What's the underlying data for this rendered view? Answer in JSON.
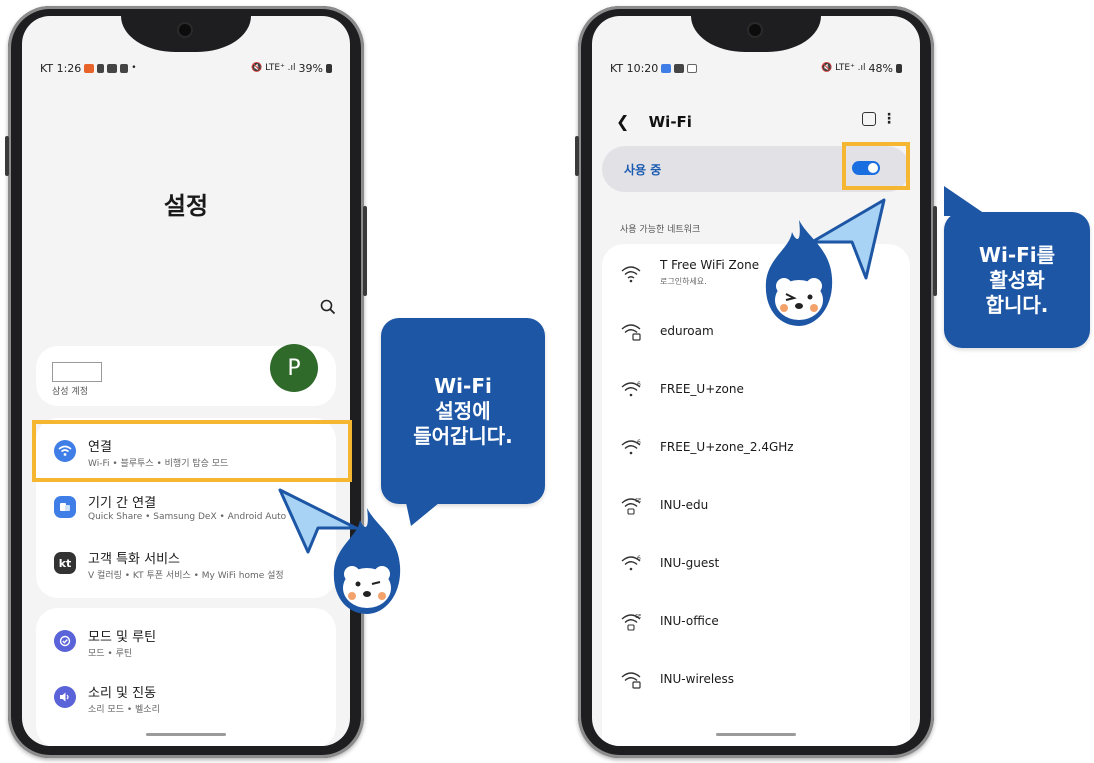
{
  "left_phone": {
    "status": {
      "time": "KT 1:26",
      "battery": "39%"
    },
    "title": "설정",
    "account": {
      "label": "삼성 계정",
      "avatar_letter": "P"
    },
    "menu": [
      {
        "title": "연결",
        "subtitle": "Wi-Fi • 블루투스 • 비행기 탑승 모드",
        "icon": "wifi-icon",
        "color": "#3f7ee6"
      },
      {
        "title": "기기 간 연결",
        "subtitle": "Quick Share • Samsung DeX • Android Auto",
        "icon": "devices-icon",
        "color": "#3f7ee6"
      },
      {
        "title": "고객 특화 서비스",
        "subtitle": "V 컬러링 • KT 투폰 서비스 • My WiFi home 설정",
        "icon": "kt-icon",
        "color": "#333333"
      },
      {
        "title": "모드 및 루틴",
        "subtitle": "모드 • 루틴",
        "icon": "routine-icon",
        "color": "#5a63d8"
      },
      {
        "title": "소리 및 진동",
        "subtitle": "소리 모드 • 벨소리",
        "icon": "sound-icon",
        "color": "#5a63d8"
      }
    ]
  },
  "right_phone": {
    "status": {
      "time": "KT 10:20",
      "battery": "48%"
    },
    "title": "Wi-Fi",
    "toggle_label": "사용 중",
    "section_label": "사용 가능한 네트워크",
    "networks": [
      {
        "name": "T Free WiFi Zone",
        "sub": "로그인하세요."
      },
      {
        "name": "eduroam",
        "sub": ""
      },
      {
        "name": "FREE_U+zone",
        "sub": ""
      },
      {
        "name": "FREE_U+zone_2.4GHz",
        "sub": ""
      },
      {
        "name": "INU-edu",
        "sub": ""
      },
      {
        "name": "INU-guest",
        "sub": ""
      },
      {
        "name": "INU-office",
        "sub": ""
      },
      {
        "name": "INU-wireless",
        "sub": ""
      }
    ]
  },
  "bubble_left": {
    "line1": "Wi-Fi",
    "line2": "설정에",
    "line3": "들어갑니다."
  },
  "bubble_right": {
    "line1": "Wi-Fi를",
    "line2": "활성화",
    "line3": "합니다."
  },
  "colors": {
    "highlight": "#f5b731",
    "bubble": "#1d56a5",
    "mascot": "#1d56a5"
  }
}
